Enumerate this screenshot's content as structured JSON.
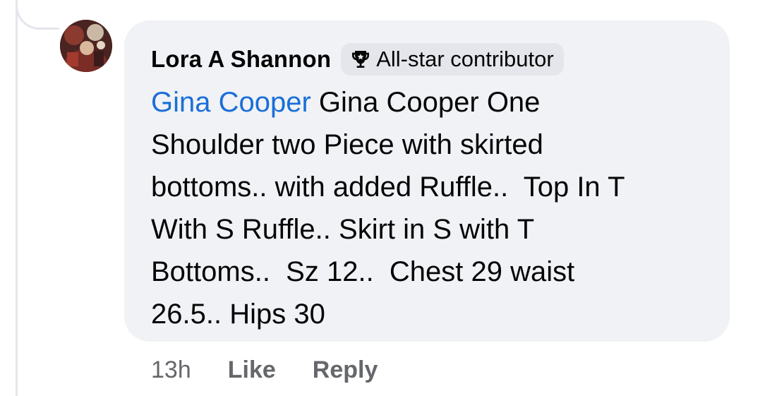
{
  "comment": {
    "author": "Lora A Shannon",
    "badge": {
      "label": "All-star contributor",
      "icon": "trophy-icon"
    },
    "mention": "Gina Cooper",
    "text": " Gina Cooper One\nShoulder two Piece with skirted\nbottoms.. with added Ruffle..  Top In T\nWith S Ruffle.. Skirt in S with T\nBottoms..  Sz 12..  Chest 29 waist\n26.5.. Hips 30",
    "timestamp": "13h",
    "actions": {
      "like": "Like",
      "reply": "Reply"
    }
  },
  "colors": {
    "bubble": "#f0f2f5",
    "badge": "#e4e6eb",
    "mention": "#1a6ed8",
    "secondary_text": "#65676b",
    "thread_line": "#e4e6eb"
  }
}
